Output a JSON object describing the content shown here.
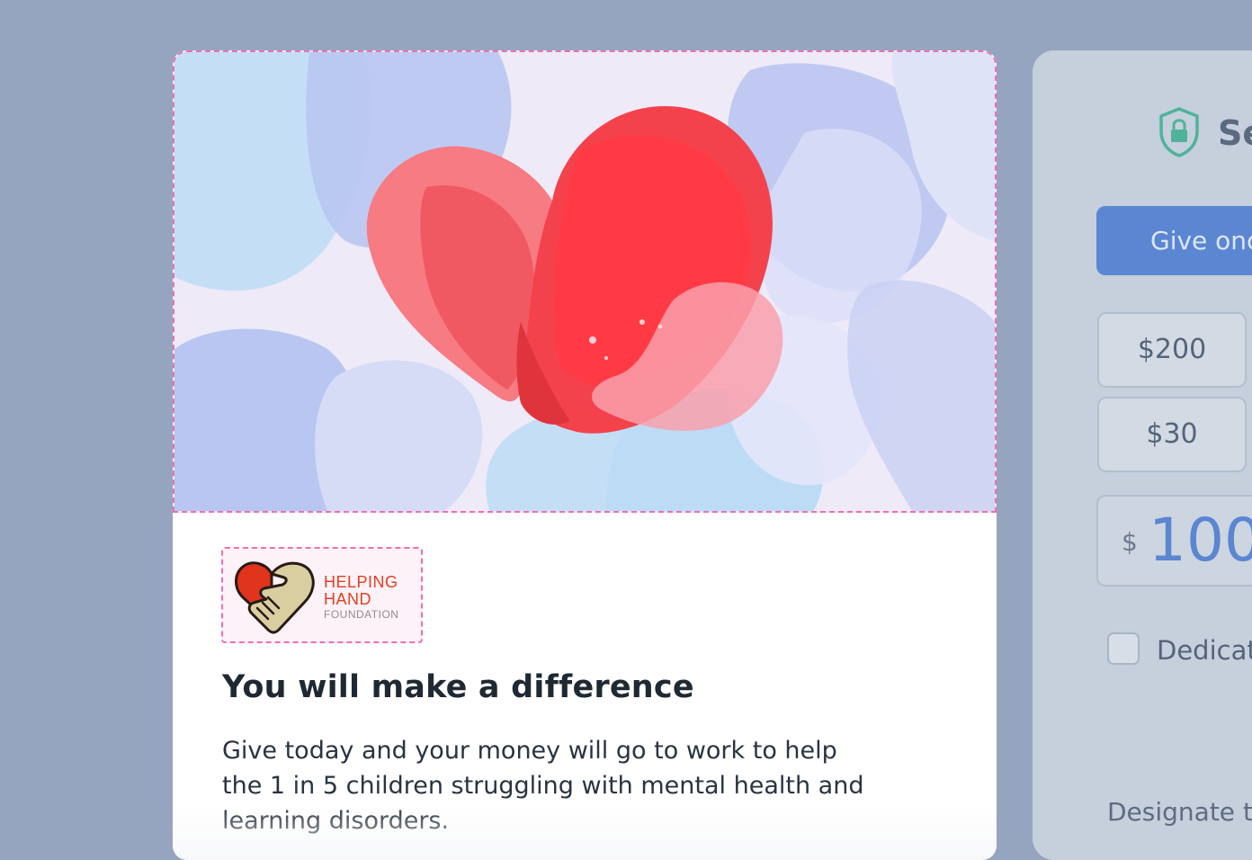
{
  "campaign": {
    "logo": {
      "line1": "HELPING",
      "line2": "HAND",
      "line3": "FOUNDATION",
      "accent_color": "#e0401f",
      "icon": "heart-handshake-icon"
    },
    "title": "You will make a difference",
    "description": "Give today and your money will go to work to help the 1 in 5 children struggling with mental health and learning disorders.",
    "hero_icon": "heart-painting"
  },
  "donation_panel": {
    "secure_icon": "shield-lock-icon",
    "secure_label": "Se",
    "frequency_button": "Give onc",
    "amounts": [
      "$200",
      "$30"
    ],
    "currency_symbol": "$",
    "custom_amount": "100",
    "dedicate_label": "Dedicat",
    "designate_label": "Designate t",
    "accent_color": "#5b86d2"
  }
}
